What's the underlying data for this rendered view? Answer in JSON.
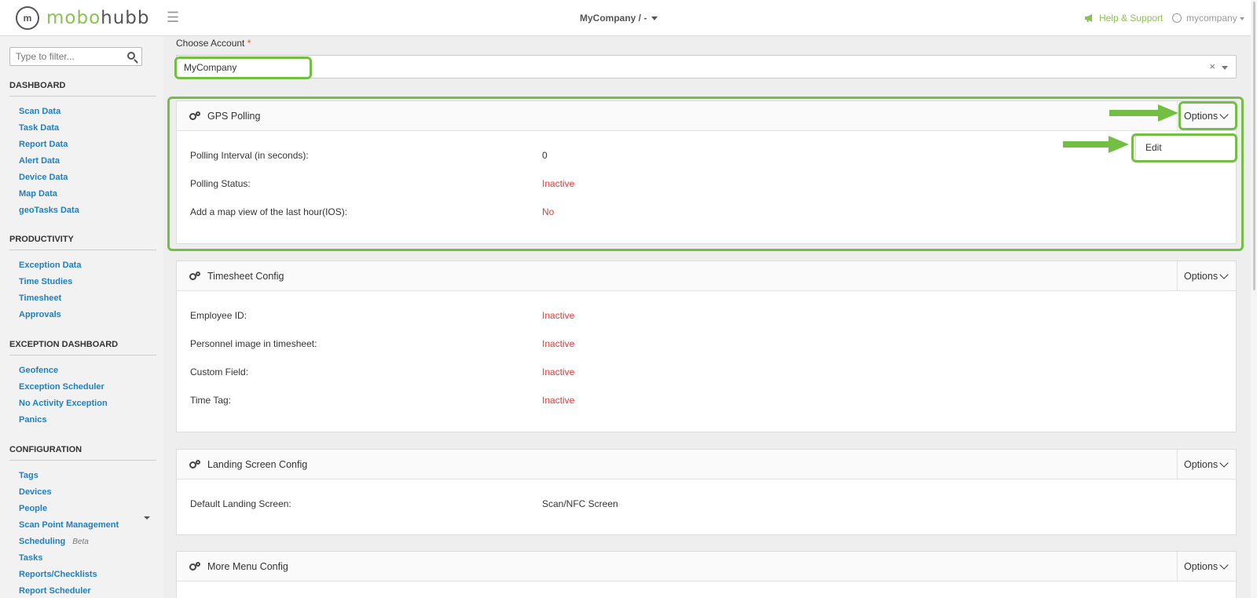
{
  "header": {
    "logo_icon": "m",
    "logo_part1": "mobo",
    "logo_part2": "hubb",
    "company_selector": "MyCompany / -",
    "help_label": "Help & Support",
    "user_label": "mycompany"
  },
  "sidebar": {
    "filter_placeholder": "Type to filter...",
    "sections": [
      {
        "title": "DASHBOARD",
        "items": [
          "Scan Data",
          "Task Data",
          "Report Data",
          "Alert Data",
          "Device Data",
          "Map Data",
          "geoTasks Data"
        ]
      },
      {
        "title": "PRODUCTIVITY",
        "items": [
          "Exception Data",
          "Time Studies",
          "Timesheet",
          "Approvals"
        ]
      },
      {
        "title": "EXCEPTION DASHBOARD",
        "items": [
          "Geofence",
          "Exception Scheduler",
          "No Activity Exception",
          "Panics"
        ]
      },
      {
        "title": "CONFIGURATION",
        "items": [
          "Tags",
          "Devices",
          "People",
          "Scan Point Management",
          "Scheduling",
          "Tasks",
          "Reports/Checklists",
          "Report Scheduler"
        ]
      }
    ],
    "beta_label": "Beta"
  },
  "account": {
    "label": "Choose Account",
    "required_mark": "*",
    "value": "MyCompany",
    "clear": "×"
  },
  "panels": [
    {
      "title": "GPS Polling",
      "options": "Options",
      "rows": [
        {
          "label": "Polling Interval (in seconds):",
          "value": "0"
        },
        {
          "label": "Polling Status:",
          "value": "Inactive"
        },
        {
          "label": "Add a map view of the last hour(IOS):",
          "value": "No"
        }
      ]
    },
    {
      "title": "Timesheet Config",
      "options": "Options",
      "rows": [
        {
          "label": "Employee ID:",
          "value": "Inactive"
        },
        {
          "label": "Personnel image in timesheet:",
          "value": "Inactive"
        },
        {
          "label": "Custom Field:",
          "value": "Inactive"
        },
        {
          "label": "Time Tag:",
          "value": "Inactive"
        }
      ]
    },
    {
      "title": "Landing Screen Config",
      "options": "Options",
      "rows": [
        {
          "label": "Default Landing Screen:",
          "value": "Scan/NFC Screen"
        }
      ]
    },
    {
      "title": "More Menu Config",
      "options": "Options",
      "rows": []
    }
  ],
  "dropdown_menu": {
    "edit": "Edit"
  },
  "colors": {
    "brand_green": "#8cc152",
    "highlight_green": "#72bf44",
    "link_blue": "#1e7fc2",
    "inactive_red": "#e53935"
  }
}
